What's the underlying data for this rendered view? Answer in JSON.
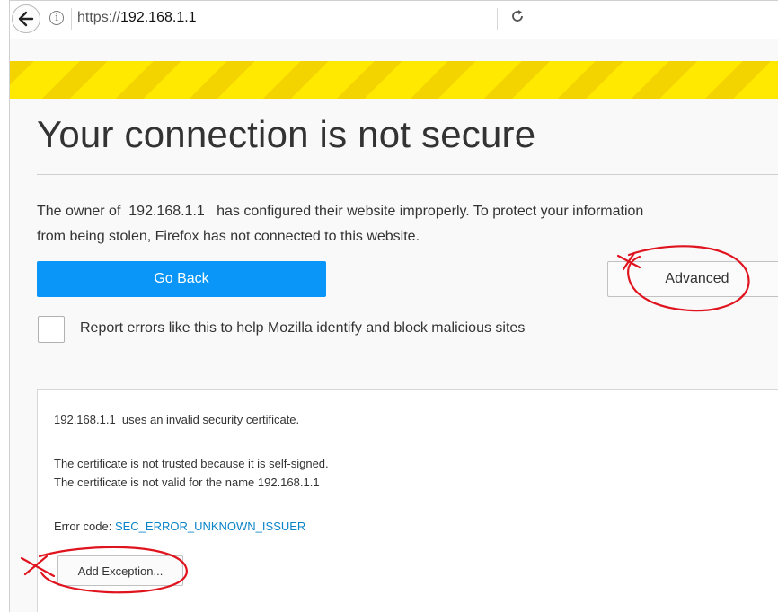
{
  "urlbar": {
    "url_scheme": "https://",
    "url_host": "192.168.1.1",
    "back_icon": "back-arrow-icon",
    "info_icon": "info-icon",
    "reload_icon": "reload-icon"
  },
  "page": {
    "title": "Your connection is not secure",
    "intro_line1": "The owner of  192.168.1.1   has configured their website improperly. To protect your information",
    "intro_line2": "from being stolen, Firefox has not connected to this website.",
    "go_back_label": "Go Back",
    "advanced_label": "Advanced",
    "report_label": "Report errors like this to help Mozilla identify and block malicious sites"
  },
  "advanced_panel": {
    "invalid_cert": "192.168.1.1  uses an invalid security certificate.",
    "reason1": "The certificate is not trusted because it is self-signed.",
    "reason2": "The certificate is not valid for the name 192.168.1.1",
    "error_code_label": "Error code:",
    "error_code": "SEC_ERROR_UNKNOWN_ISSUER",
    "add_exception_label": "Add Exception..."
  },
  "colors": {
    "accent_blue": "#0996f8",
    "warning_yellow": "#ffe900",
    "annotation_red": "#e0141e",
    "link_blue": "#0a84c8"
  }
}
